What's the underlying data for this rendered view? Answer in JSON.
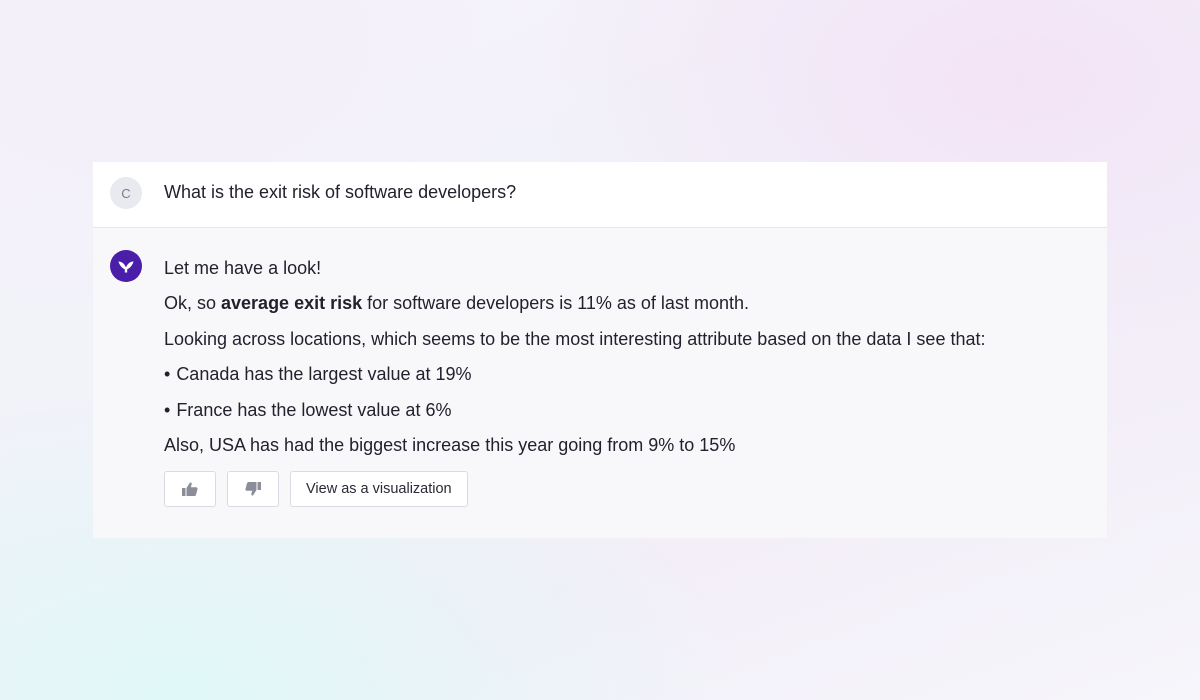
{
  "user": {
    "avatar_initial": "C",
    "question": "What is the exit risk of software developers?"
  },
  "assistant": {
    "avatar_icon": "brand-logo-icon",
    "avatar_color": "#4a1ea8",
    "intro": "Let me have a look!",
    "summary": {
      "prefix": "Ok, so ",
      "bold": "average exit risk",
      "suffix": " for software developers is 11% as of last month."
    },
    "context": "Looking across locations, which seems to be the most interesting attribute based on the data I see that:",
    "bullets": [
      {
        "marker": "•",
        "text": "Canada has the largest value at 19%"
      },
      {
        "marker": "•",
        "text": "France has the lowest value at 6%"
      }
    ],
    "conclusion": "Also, USA has had the biggest increase this year going from 9% to 15%"
  },
  "actions": {
    "thumbs_up_icon": "thumbs-up-icon",
    "thumbs_down_icon": "thumbs-down-icon",
    "visualize_label": "View as a visualization"
  }
}
